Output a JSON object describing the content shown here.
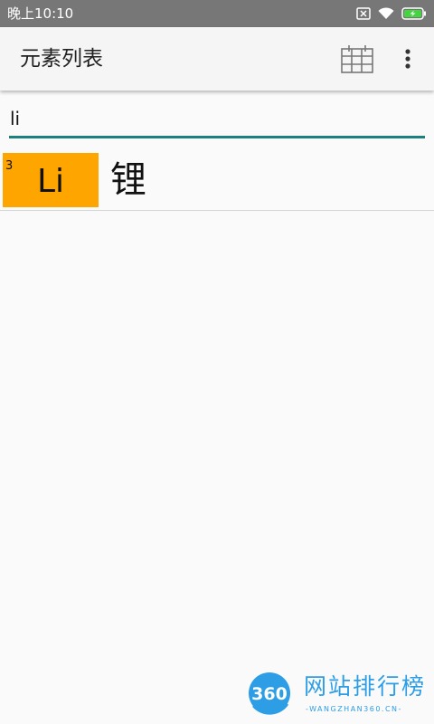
{
  "status_bar": {
    "time": "晚上10:10",
    "icons": [
      "sim-disabled-icon",
      "wifi-icon",
      "battery-charging-icon"
    ],
    "battery_color": "#43d43f"
  },
  "app_bar": {
    "title": "元素列表",
    "actions": [
      "calendar-grid-icon",
      "more-vert-icon"
    ],
    "background": "#f5f5f5"
  },
  "search": {
    "value": "li",
    "underline_color": "#1f7f7e"
  },
  "results": [
    {
      "atomic_number": "3",
      "symbol": "Li",
      "name": "锂",
      "tile_color": "#ffa500"
    }
  ],
  "watermark": {
    "badge": "360",
    "text": "网站排行榜",
    "subtext": "-WANGZHAN360.CN-",
    "color": "#2d9ee6"
  }
}
